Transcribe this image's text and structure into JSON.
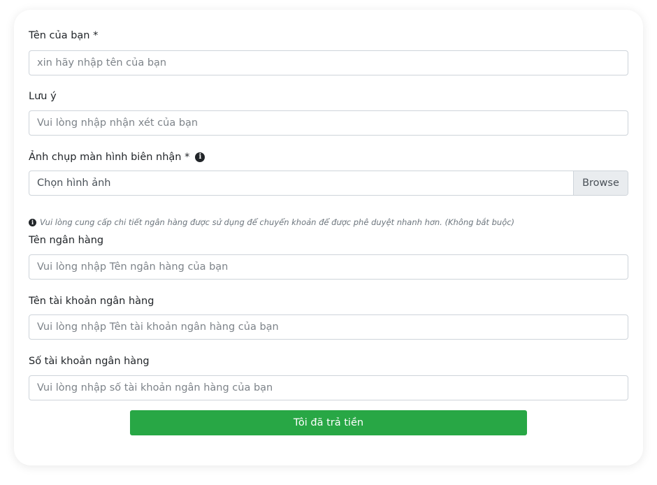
{
  "form": {
    "name": {
      "label": "Tên của bạn *",
      "placeholder": "xin hãy nhập tên của bạn"
    },
    "note": {
      "label": "Lưu ý",
      "placeholder": "Vui lòng nhập nhận xét của bạn"
    },
    "receipt": {
      "label": "Ảnh chụp màn hình biên nhận *",
      "file_text": "Chọn hình ảnh",
      "browse_label": "Browse",
      "info_icon": "info-circle-icon"
    },
    "bank_note": "Vui lòng cung cấp chi tiết ngân hàng được sử dụng để chuyển khoản để được phê duyệt nhanh hơn. (Không bắt buộc)",
    "bank_name": {
      "label": "Tên ngân hàng",
      "placeholder": "Vui lòng nhập Tên ngân hàng của bạn"
    },
    "account_name": {
      "label": "Tên tài khoản ngân hàng",
      "placeholder": "Vui lòng nhập Tên tài khoản ngân hàng của bạn"
    },
    "account_number": {
      "label": "Số tài khoản ngân hàng",
      "placeholder": "Vui lòng nhập số tài khoản ngân hàng của bạn"
    },
    "submit_label": "Tôi đã trả tiền"
  },
  "colors": {
    "accent": "#28a745",
    "border": "#ced4da",
    "placeholder": "#7d8389",
    "note": "#6c757d"
  }
}
